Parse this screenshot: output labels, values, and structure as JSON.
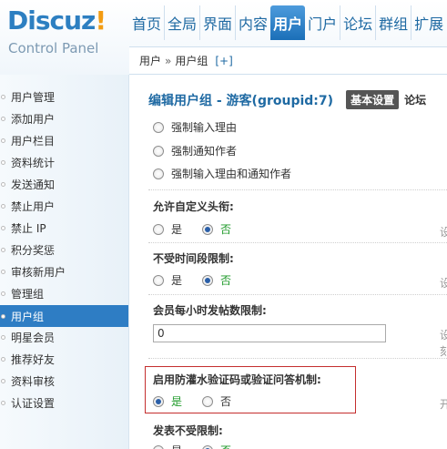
{
  "logo": {
    "brand_a": "Discuz",
    "brand_b": "!",
    "subtitle": "Control Panel"
  },
  "topnav": [
    "首页",
    "全局",
    "界面",
    "内容",
    "用户",
    "门户",
    "论坛",
    "群组",
    "扩展"
  ],
  "topnav_active": "用户",
  "breadcrumb": {
    "first": "用户",
    "arrow": "»",
    "second": "用户组",
    "plus": "[+]"
  },
  "sidebar": {
    "items": [
      "用户管理",
      "添加用户",
      "用户栏目",
      "资料统计",
      "发送通知",
      "禁止用户",
      "禁止 IP",
      "积分奖惩",
      "审核新用户",
      "管理组",
      "用户组",
      "明星会员",
      "推荐好友",
      "资料审核",
      "认证设置"
    ],
    "active": "用户组"
  },
  "page": {
    "title": "编辑用户组 - 游客(groupid:7)",
    "tab_basic": "基本设置",
    "tab_forum": "论坛"
  },
  "options_top": {
    "cut_off": "强制输入理由",
    "notify": "强制通知作者",
    "both": "强制输入理由和通知作者"
  },
  "custom_title": {
    "label": "允许自定义头衔:",
    "yes": "是",
    "no": "否",
    "selected": "no",
    "hint": "设"
  },
  "time_limit": {
    "label": "不受时间段限制:",
    "yes": "是",
    "no": "否",
    "selected": "no",
    "hint": "设"
  },
  "post_limit": {
    "label": "会员每小时发帖数限制:",
    "value": "0",
    "hint": "设",
    "hint2": "刻"
  },
  "anti_flood": {
    "label": "启用防灌水验证码或验证问答机制:",
    "yes": "是",
    "no": "否",
    "selected": "yes",
    "hint": "开"
  },
  "post_unlimited": {
    "label": "发表不受限制:",
    "yes": "是",
    "no": "否"
  },
  "colors": {
    "accent": "#2e7dc4",
    "selected_text": "#1f9a2a",
    "highlight_border": "#c42e2e"
  }
}
